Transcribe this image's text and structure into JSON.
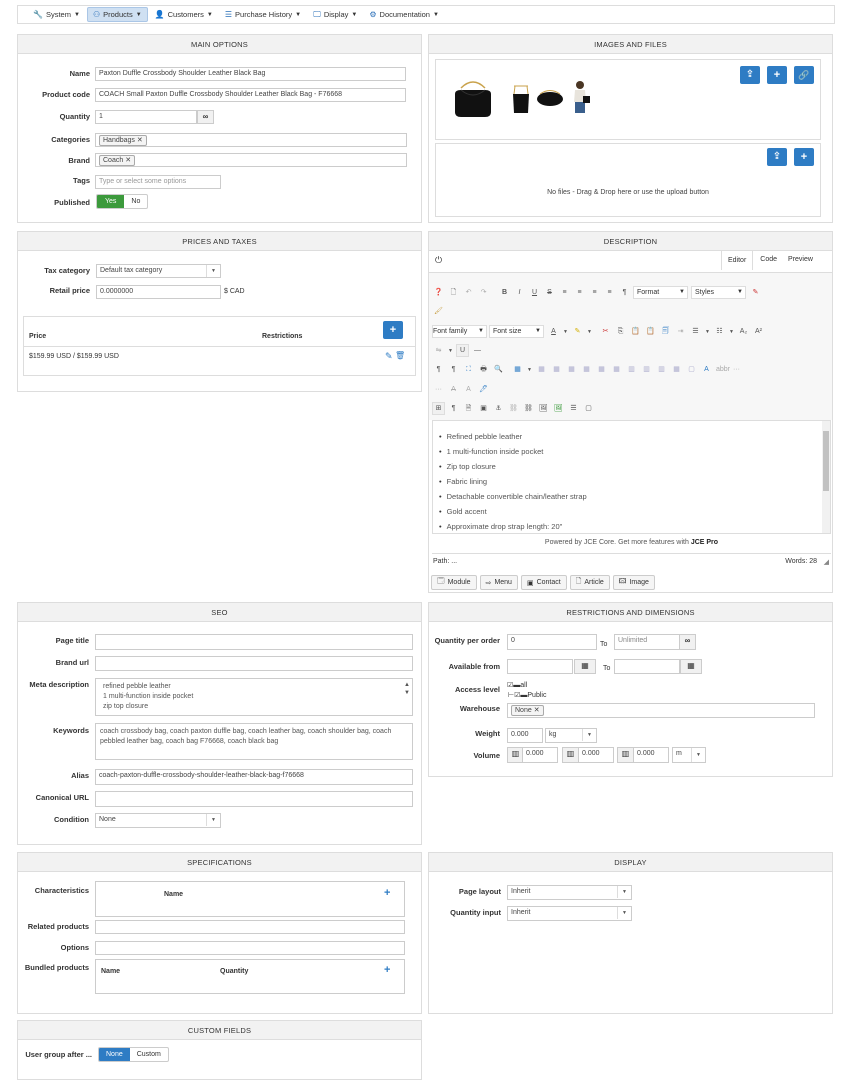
{
  "nav": {
    "items": [
      {
        "label": "System",
        "icon": "wrench-icon"
      },
      {
        "label": "Products",
        "icon": "products-icon"
      },
      {
        "label": "Customers",
        "icon": "user-icon"
      },
      {
        "label": "Purchase History",
        "icon": "list-icon"
      },
      {
        "label": "Display",
        "icon": "monitor-icon"
      },
      {
        "label": "Documentation",
        "icon": "gear-icon"
      }
    ]
  },
  "main": {
    "title": "MAIN OPTIONS",
    "name_label": "Name",
    "name_value": "Paxton Duffle Crossbody Shoulder Leather Black Bag",
    "code_label": "Product code",
    "code_value": "COACH Small Paxton Duffle Crossbody Shoulder Leather Black Bag - F76668",
    "qty_label": "Quantity",
    "qty_value": "1",
    "qty_inf": "∞",
    "cat_label": "Categories",
    "cat_tag": "Handbags",
    "brand_label": "Brand",
    "brand_tag": "Coach",
    "tags_label": "Tags",
    "tags_placeholder": "Type or select some options",
    "pub_label": "Published",
    "pub_yes": "Yes",
    "pub_no": "No"
  },
  "images": {
    "title": "IMAGES AND FILES",
    "files_text": "No files - Drag & Drop here or use the upload button"
  },
  "prices": {
    "title": "PRICES AND TAXES",
    "tax_label": "Tax category",
    "tax_value": "Default tax category",
    "retail_label": "Retail price",
    "retail_value": "0.0000000",
    "currency": "$ CAD",
    "col_price": "Price",
    "col_restr": "Restrictions",
    "row_price": "$159.99 USD / $159.99 USD"
  },
  "desc": {
    "title": "DESCRIPTION",
    "tab_editor": "Editor",
    "tab_code": "Code",
    "tab_preview": "Preview",
    "format": "Format",
    "styles": "Styles",
    "font_family": "Font family",
    "font_size": "Font size",
    "bullets": [
      "Refined pebble leather",
      "1 multi-function inside pocket",
      "Zip top closure",
      "Fabric lining",
      "Detachable convertible chain/leather strap",
      "Gold accent",
      "Approximate drop strap length: 20\""
    ],
    "powered": "Powered by JCE Core. Get more features with ",
    "powered_pro": "JCE Pro",
    "path": "Path: ...",
    "words": "Words: 28",
    "btn_module": "Module",
    "btn_menu": "Menu",
    "btn_contact": "Contact",
    "btn_article": "Article",
    "btn_image": "Image"
  },
  "seo": {
    "title": "SEO",
    "page_title_label": "Page title",
    "brand_url_label": "Brand url",
    "meta_label": "Meta description",
    "meta_lines": [
      "refined pebble leather",
      "1 multi-function inside pocket",
      "zip top closure"
    ],
    "keywords_label": "Keywords",
    "keywords_value": "coach crossbody bag, coach paxton duffle bag, coach leather bag, coach shoulder bag, coach pebbled leather bag, coach bag F76668, coach black bag",
    "alias_label": "Alias",
    "alias_value": "coach-paxton-duffle-crossbody-shoulder-leather-black-bag-f76668",
    "canonical_label": "Canonical URL",
    "condition_label": "Condition",
    "condition_value": "None"
  },
  "restr": {
    "title": "RESTRICTIONS AND DIMENSIONS",
    "qpo_label": "Quantity per order",
    "qpo_value": "0",
    "to": "To",
    "qpo_to": "Unlimited",
    "avail_label": "Available from",
    "access_label": "Access level",
    "access_all": "all",
    "access_public": "Public",
    "warehouse_label": "Warehouse",
    "warehouse_tag": "None",
    "weight_label": "Weight",
    "weight_value": "0.000",
    "weight_unit": "kg",
    "volume_label": "Volume",
    "vol1": "0.000",
    "vol2": "0.000",
    "vol3": "0.000",
    "vol_unit": "m"
  },
  "specs": {
    "title": "SPECIFICATIONS",
    "char_label": "Characteristics",
    "char_name": "Name",
    "related_label": "Related products",
    "options_label": "Options",
    "bundled_label": "Bundled products",
    "bundled_name": "Name",
    "bundled_qty": "Quantity"
  },
  "display": {
    "title": "DISPLAY",
    "layout_label": "Page layout",
    "layout_value": "Inherit",
    "qinput_label": "Quantity input",
    "qinput_value": "Inherit"
  },
  "custom": {
    "title": "CUSTOM FIELDS",
    "ug_label": "User group after ...",
    "none": "None",
    "custom": "Custom"
  }
}
